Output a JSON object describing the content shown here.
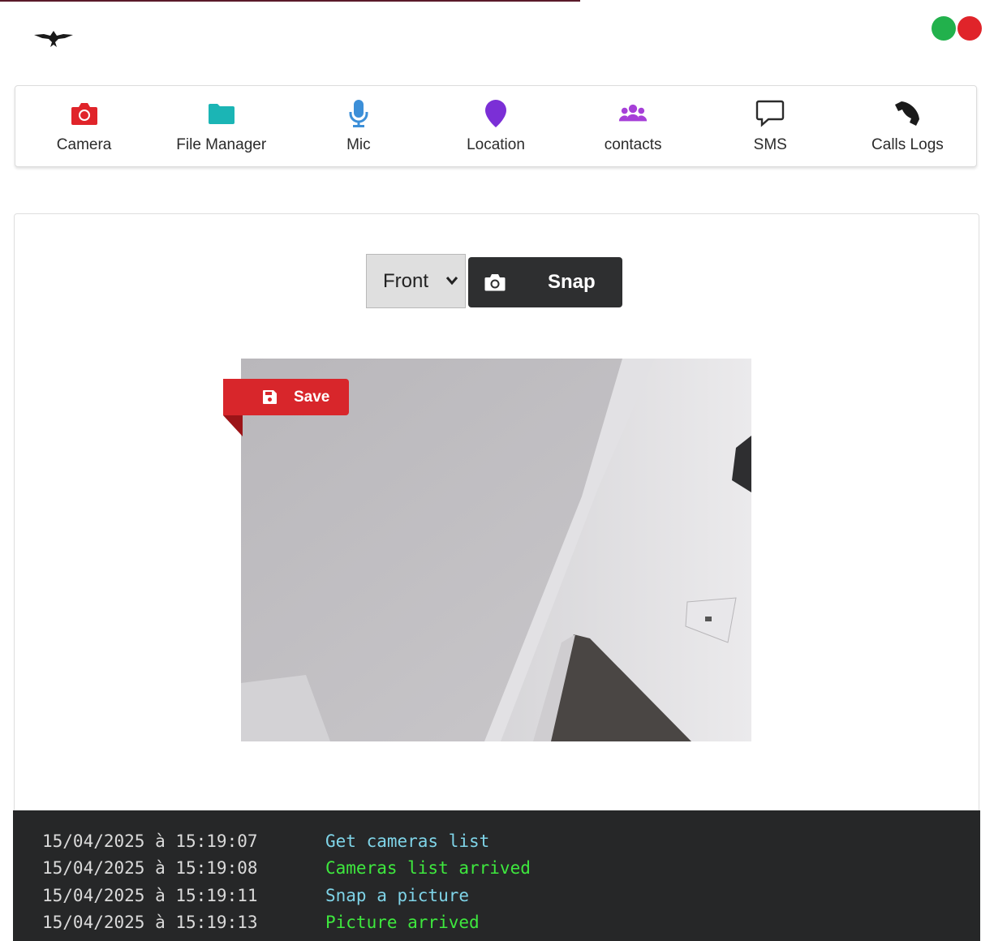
{
  "header": {
    "logo": "eagle-logo-icon",
    "status": {
      "connected_color": "#22b14c",
      "disconnected_color": "#e0242a"
    }
  },
  "nav": {
    "items": [
      {
        "label": "Camera",
        "icon": "camera-icon",
        "color": "#e0242a"
      },
      {
        "label": "File Manager",
        "icon": "folder-icon",
        "color": "#1bb5b5"
      },
      {
        "label": "Mic",
        "icon": "microphone-icon",
        "color": "#3c8fd8"
      },
      {
        "label": "Location",
        "icon": "map-pin-icon",
        "color": "#7b2fd6"
      },
      {
        "label": "contacts",
        "icon": "users-icon",
        "color": "#a63fd8"
      },
      {
        "label": "SMS",
        "icon": "message-icon",
        "color": "#2b2b2b"
      },
      {
        "label": "Calls Logs",
        "icon": "phone-icon",
        "color": "#1a1a1a"
      }
    ]
  },
  "camera": {
    "selected_camera": "Front",
    "snap_label": "Snap",
    "save_label": "Save"
  },
  "console": {
    "logs": [
      {
        "time": "15/04/2025 à 15:19:07",
        "message": "Get cameras list",
        "kind": "request"
      },
      {
        "time": "15/04/2025 à 15:19:08",
        "message": "Cameras list arrived",
        "kind": "response"
      },
      {
        "time": "15/04/2025 à 15:19:11",
        "message": "Snap a picture",
        "kind": "request"
      },
      {
        "time": "15/04/2025 à 15:19:13",
        "message": "Picture arrived",
        "kind": "response"
      }
    ]
  }
}
